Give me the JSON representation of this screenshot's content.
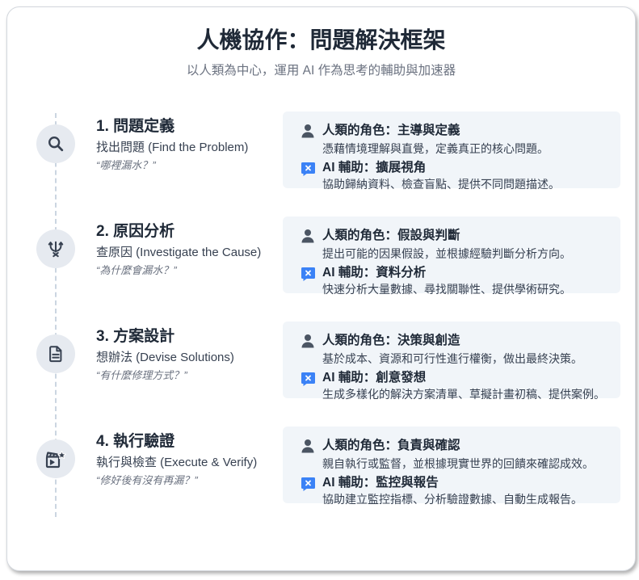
{
  "header": {
    "title": "人機協作：問題解決框架",
    "subtitle": "以人類為中心，運用 AI 作為思考的輔助與加速器"
  },
  "steps": [
    {
      "icon": "search-icon",
      "title": "1. 問題定義",
      "subtitle": "找出問題 (Find the Problem)",
      "quote": "“哪裡漏水？”",
      "human": {
        "icon": "person-icon",
        "heading": "人類的角色：主導與定義",
        "text": "憑藉情境理解與直覺，定義真正的核心問題。"
      },
      "ai": {
        "icon": "ai-chat-icon",
        "heading": "AI 輔助：擴展視角",
        "text": "協助歸納資料、檢查盲點、提供不同問題描述。"
      }
    },
    {
      "icon": "trident-branch-icon",
      "title": "2. 原因分析",
      "subtitle": "查原因 (Investigate the Cause)",
      "quote": "“為什麼會漏水？”",
      "human": {
        "icon": "person-icon",
        "heading": "人類的角色：假設與判斷",
        "text": "提出可能的因果假設，並根據經驗判斷分析方向。"
      },
      "ai": {
        "icon": "ai-chat-icon",
        "heading": "AI 輔助：資料分析",
        "text": "快速分析大量數據、尋找關聯性、提供學術研究。"
      }
    },
    {
      "icon": "document-icon",
      "title": "3. 方案設計",
      "subtitle": "想辦法 (Devise Solutions)",
      "quote": "“有什麼修理方式？”",
      "human": {
        "icon": "person-icon",
        "heading": "人類的角色：決策與創造",
        "text": "基於成本、資源和可行性進行權衡，做出最終決策。"
      },
      "ai": {
        "icon": "ai-chat-icon",
        "heading": "AI 輔助：創意發想",
        "text": "生成多樣化的解決方案清單、草擬計畫初稿、提供案例。"
      }
    },
    {
      "icon": "clapperboard-star-icon",
      "title": "4. 執行驗證",
      "subtitle": "執行與檢查 (Execute & Verify)",
      "quote": "“修好後有沒有再漏？”",
      "human": {
        "icon": "person-icon",
        "heading": "人類的角色：負責與確認",
        "text": "親自執行或監督，並根據現實世界的回饋來確認成效。"
      },
      "ai": {
        "icon": "ai-chat-icon",
        "heading": "AI 輔助：監控與報告",
        "text": "協助建立監控指標、分析驗證數據、自動生成報告。"
      }
    }
  ],
  "colors": {
    "card_bg": "#ffffff",
    "panel_bg": "#f1f5f9",
    "circle_bg": "#e6eaf0",
    "accent": "#3b82f6",
    "title": "#1f2937",
    "muted": "#6b7280"
  }
}
